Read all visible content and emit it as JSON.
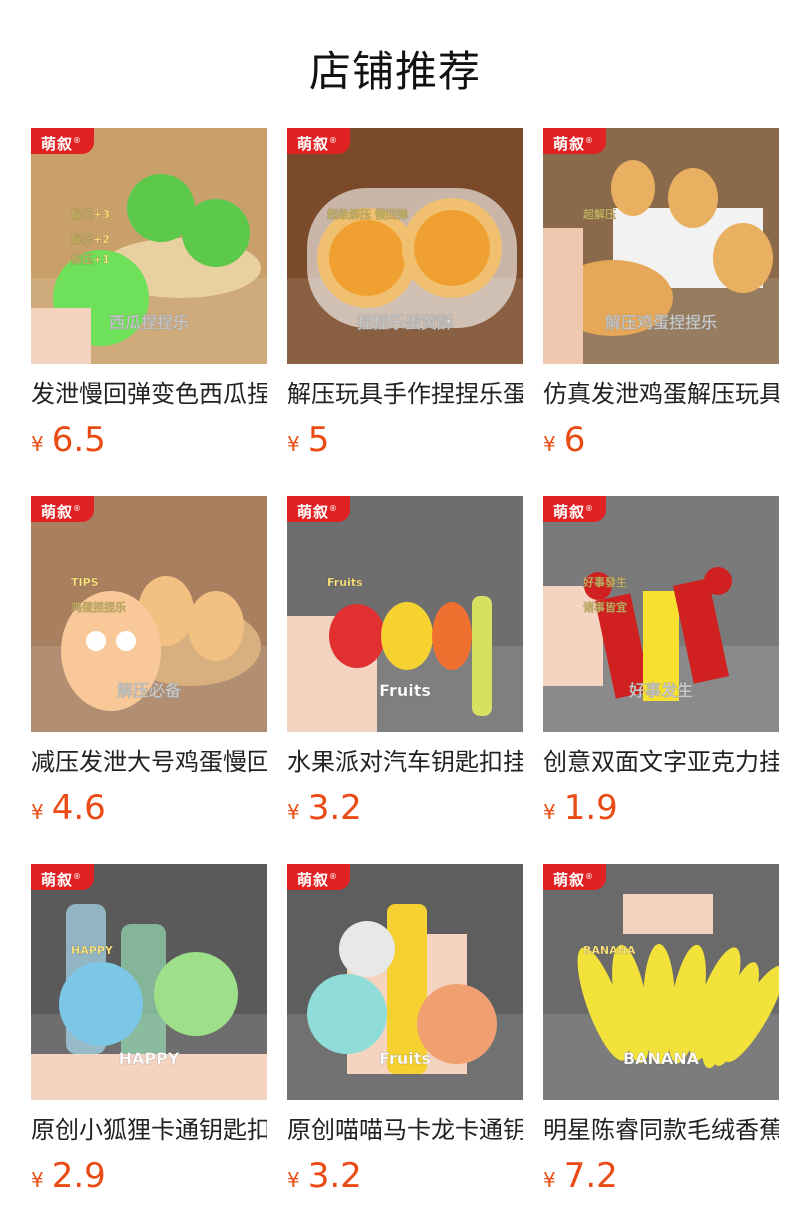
{
  "header": {
    "title": "店铺推荐"
  },
  "brand_badge": "萌叙",
  "currency": "¥",
  "products": [
    {
      "title": "发泄慢回弹变色西瓜捏捏乐",
      "price": "6.5",
      "image_texts": [
        "西瓜捏捏乐",
        "解压+3",
        "解压+2",
        "解压+1"
      ],
      "bg": "#c9a06a",
      "accent": "#5cc94a"
    },
    {
      "title": "解压玩具手作捏捏乐蛋黄酥",
      "price": "5",
      "image_texts": [
        "捏捏乐蛋黄酥",
        "超级解压 慢回弹"
      ],
      "bg": "#7a4a2a",
      "accent": "#f0a030"
    },
    {
      "title": "仿真发泄鸡蛋解压玩具",
      "price": "6",
      "image_texts": [
        "解压鸡蛋捏捏乐",
        "超解压"
      ],
      "bg": "#8a6a4a",
      "accent": "#e8b060"
    },
    {
      "title": "减压发泄大号鸡蛋慢回弹",
      "price": "4.6",
      "image_texts": [
        "解压必备",
        "TIPS",
        "鸡蛋捏捏乐"
      ],
      "bg": "#a88060",
      "accent": "#f2c080"
    },
    {
      "title": "水果派对汽车钥匙扣挂件",
      "price": "3.2",
      "image_texts": [
        "Fruits",
        "Fruits"
      ],
      "bg": "#6e6e6e",
      "accent": "#e03030"
    },
    {
      "title": "创意双面文字亚克力挂件",
      "price": "1.9",
      "image_texts": [
        "好事发生",
        "好事發生",
        "诸事皆宜"
      ],
      "bg": "#7a7a7a",
      "accent": "#d02020"
    },
    {
      "title": "原创小狐狸卡通钥匙扣",
      "price": "2.9",
      "image_texts": [
        "HAPPY",
        "HAPPY"
      ],
      "bg": "#5a5a5a",
      "accent": "#7cc6e6"
    },
    {
      "title": "原创喵喵马卡龙卡通钥匙扣",
      "price": "3.2",
      "image_texts": [
        "Fruits"
      ],
      "bg": "#5e5e5e",
      "accent": "#f0a070"
    },
    {
      "title": "明星陈睿同款毛绒香蕉挂件",
      "price": "7.2",
      "image_texts": [
        "BANANA",
        "BANANA"
      ],
      "bg": "#6a6a6a",
      "accent": "#f3e23a"
    }
  ],
  "colors": {
    "price": "#ea4b14",
    "badge": "#e02222"
  }
}
